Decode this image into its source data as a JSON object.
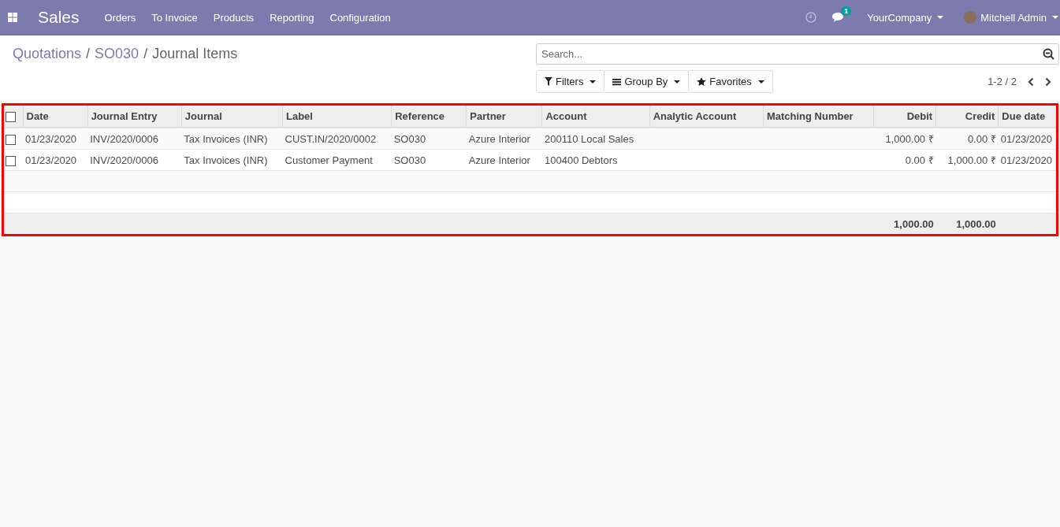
{
  "navbar": {
    "app": "Sales",
    "menu": [
      "Orders",
      "To Invoice",
      "Products",
      "Reporting",
      "Configuration"
    ],
    "messages_badge": "1",
    "company": "YourCompany",
    "user": "Mitchell Admin"
  },
  "breadcrumb": [
    {
      "kind": "link",
      "label": "Quotations"
    },
    {
      "kind": "separator",
      "label": "/"
    },
    {
      "kind": "link",
      "label": "SO030"
    },
    {
      "kind": "separator",
      "label": "/"
    },
    {
      "kind": "current",
      "label": "Journal Items"
    }
  ],
  "search": {
    "placeholder": "Search..."
  },
  "filters": [
    "Filters",
    "Group By",
    "Favorites"
  ],
  "pager": "1-2 / 2",
  "table": {
    "select_all": false,
    "columns": [
      {
        "label": "Date",
        "kind": "text"
      },
      {
        "label": "Journal Entry",
        "kind": "text"
      },
      {
        "label": "Journal",
        "kind": "text"
      },
      {
        "label": "Label",
        "kind": "text"
      },
      {
        "label": "Reference",
        "kind": "text"
      },
      {
        "label": "Partner",
        "kind": "text"
      },
      {
        "label": "Account",
        "kind": "text"
      },
      {
        "label": "Analytic Account",
        "kind": "text"
      },
      {
        "label": "Matching Number",
        "kind": "text"
      },
      {
        "label": "Debit",
        "kind": "number",
        "total": "1,000.00"
      },
      {
        "label": "Credit",
        "kind": "number",
        "total": "1,000.00"
      },
      {
        "label": "Due date",
        "kind": "text"
      }
    ],
    "rows": [
      {
        "checked": false,
        "cells": [
          "01/23/2020",
          "INV/2020/0006",
          "Tax Invoices (INR)",
          "CUST.IN/2020/0002",
          "SO030",
          "Azure Interior",
          "200110 Local Sales",
          "",
          "",
          "1,000.00 ₹",
          "0.00 ₹",
          "01/23/2020"
        ]
      },
      {
        "checked": false,
        "cells": [
          "01/23/2020",
          "INV/2020/0006",
          "Tax Invoices (INR)",
          "Customer Payment",
          "SO030",
          "Azure Interior",
          "100400 Debtors",
          "",
          "",
          "0.00 ₹",
          "1,000.00 ₹",
          "01/23/2020"
        ]
      }
    ]
  }
}
